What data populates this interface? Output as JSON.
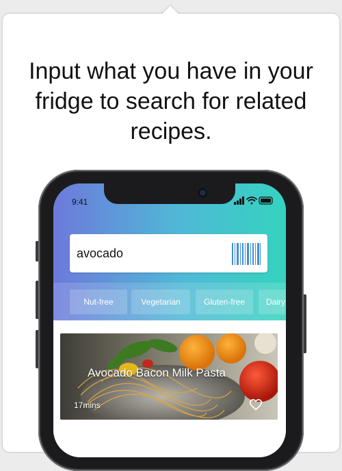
{
  "headline": "Input what you have in your fridge to search for related recipes.",
  "status_bar": {
    "time": "9:41",
    "icons": [
      "signal-icon",
      "wifi-icon",
      "battery-icon"
    ]
  },
  "search": {
    "value": "avocado",
    "scan_icon": "barcode-icon"
  },
  "filters": [
    "Nut-free",
    "Vegetarian",
    "Gluten-free",
    "Dairy"
  ],
  "recipe": {
    "title": "Avocado Bacon Milk Pasta",
    "time": "17mins",
    "favorite_icon": "heart-icon"
  },
  "colors": {
    "gradient_start": "#6d79dc",
    "gradient_mid": "#4fb9d6",
    "gradient_end": "#35d3bf"
  }
}
